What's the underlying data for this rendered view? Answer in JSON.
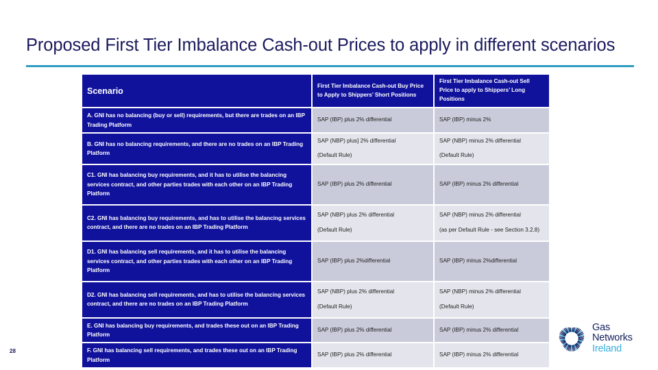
{
  "slide": {
    "title": "Proposed First Tier Imbalance Cash-out Prices to apply in different scenarios",
    "page_number": "28",
    "accent_color": "#2e9bc0",
    "title_color": "#1a1a5e",
    "table_header_color": "#11129c",
    "row_shade_dark": "#c9cbda",
    "row_shade_light": "#e4e5ec"
  },
  "table": {
    "headers": {
      "scenario": "Scenario",
      "buy_price": "First Tier Imbalance Cash-out Buy Price to Apply to Shippers’ Short Positions",
      "sell_price": "First Tier Imbalance Cash-out Sell Price to apply to Shippers’ Long Positions"
    },
    "rows": [
      {
        "id": "A",
        "scenario": "A.  GNI has no balancing (buy or sell) requirements, but there are trades on an IBP Trading Platform",
        "buy": [
          "SAP (IBP) plus 2% differential"
        ],
        "sell": [
          "SAP (IBP) minus 2%"
        ]
      },
      {
        "id": "B",
        "scenario": "B.  GNI has no balancing requirements, and there are no trades on an IBP Trading Platform",
        "buy": [
          "SAP (NBP) plus] 2% differential",
          "(Default Rule)"
        ],
        "sell": [
          "SAP (NBP) minus 2% differential",
          "(Default Rule)"
        ]
      },
      {
        "id": "C1",
        "scenario": "C1.  GNI has balancing buy requirements, and it has to utilise the balancing services contract, and other parties trades with each other on an IBP Trading Platform",
        "buy": [
          "SAP (IBP) plus 2% differential"
        ],
        "sell": [
          "SAP (IBP) minus 2% differential"
        ]
      },
      {
        "id": "C2",
        "scenario": "C2.  GNI has balancing buy requirements, and has to utilise the balancing services contract, and there are no trades on an IBP Trading Platform",
        "buy": [
          "SAP (NBP) plus 2% differential",
          "(Default Rule)"
        ],
        "sell": [
          "SAP (NBP) minus 2% differential",
          "(as per Default Rule - see Section 3.2.8)"
        ]
      },
      {
        "id": "D1",
        "scenario": "D1.  GNI has balancing sell requirements, and it has to utilise the balancing services contract, and other parties trades with each other on an IBP Trading Platform",
        "buy": [
          "SAP (IBP) plus 2%differential"
        ],
        "sell": [
          "SAP (IBP) minus 2%differential"
        ]
      },
      {
        "id": "D2",
        "scenario": "D2.  GNI has balancing sell requirements, and has to utilise the balancing services contract, and there are no trades on an IBP Trading Platform",
        "buy": [
          "SAP (NBP) plus 2% differential",
          "(Default Rule)"
        ],
        "sell": [
          "SAP (NBP) minus 2% differential",
          "(Default Rule)"
        ]
      },
      {
        "id": "E",
        "scenario": "E.  GNI has balancing buy requirements, and trades these out on an IBP Trading Platform",
        "buy": [
          "SAP (IBP) plus 2% differential"
        ],
        "sell": [
          "SAP (IBP) minus 2% differential"
        ]
      },
      {
        "id": "F",
        "scenario": "F.  GNI has balancing sell requirements, and trades these out on an IBP Trading Platform",
        "buy": [
          "SAP (IBP) plus 2% differential"
        ],
        "sell": [
          "SAP (IBP) minus 2% differential"
        ]
      }
    ]
  },
  "logo": {
    "line1": "Gas",
    "line2": "Networks",
    "line3": "Ireland",
    "mark_color": "#14205c",
    "ireland_color": "#36aee0"
  }
}
